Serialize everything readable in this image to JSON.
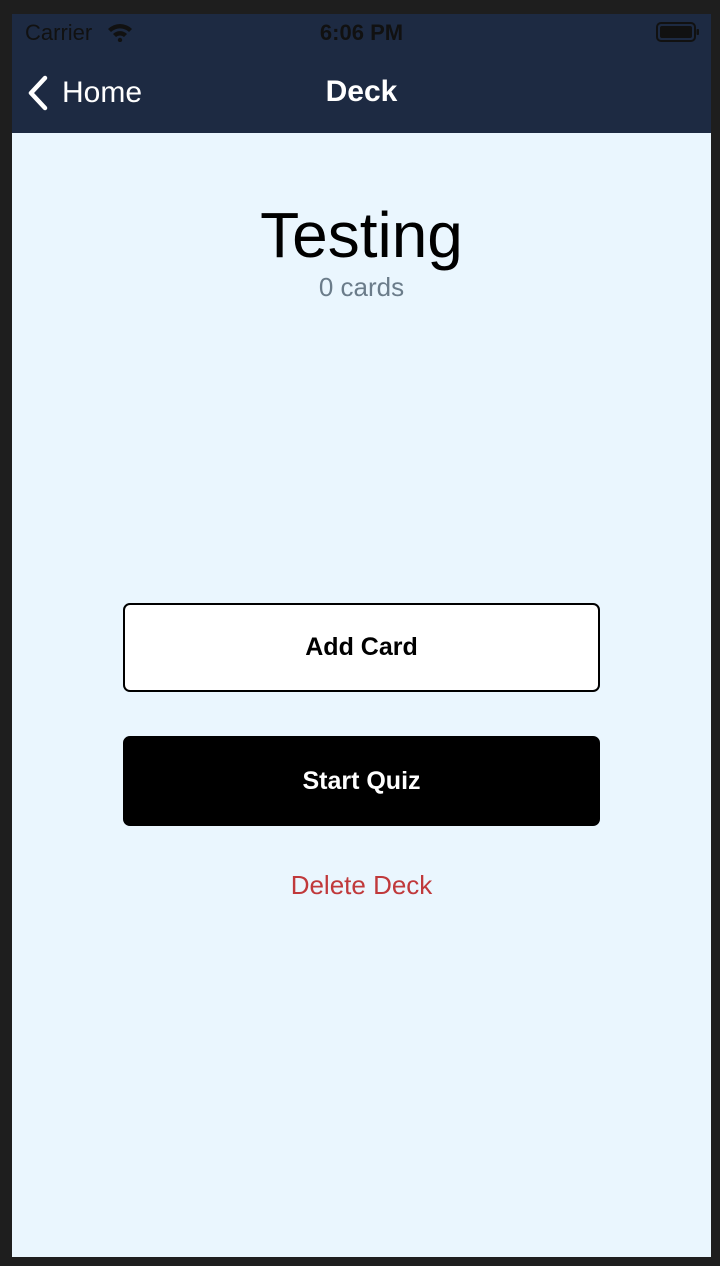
{
  "status_bar": {
    "carrier": "Carrier",
    "time": "6:06 PM",
    "icons": [
      "wifi-icon",
      "battery-icon"
    ]
  },
  "nav": {
    "back_label": "Home",
    "title": "Deck",
    "back_icon": "chevron-left-icon"
  },
  "deck": {
    "title": "Testing",
    "count_text": "0 cards"
  },
  "actions": {
    "add_card_label": "Add Card",
    "start_quiz_label": "Start Quiz",
    "delete_deck_label": "Delete Deck"
  },
  "colors": {
    "nav_background": "#1d2a42",
    "content_background": "#eaf6fe",
    "delete_text": "#c0393b",
    "subtitle_text": "#6b7c8a"
  }
}
